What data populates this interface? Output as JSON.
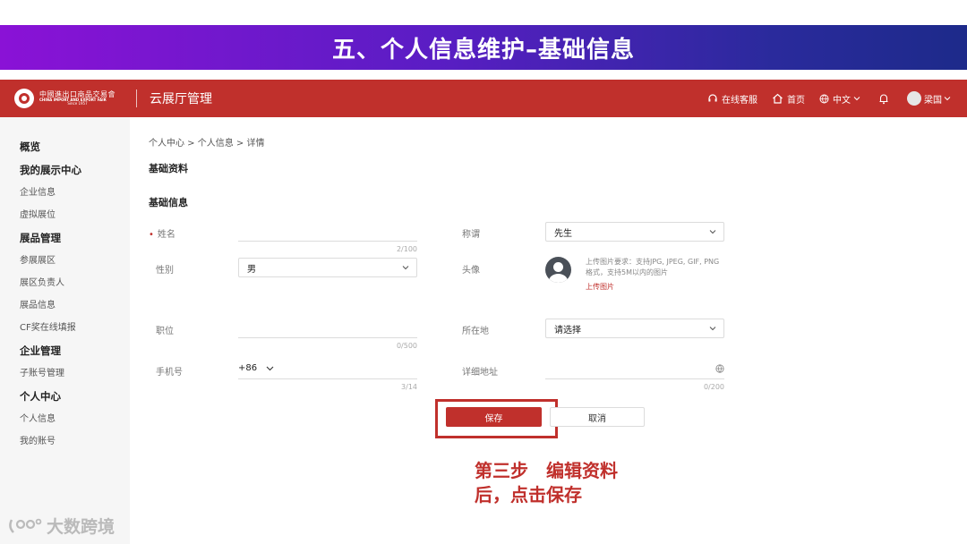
{
  "banner": {
    "title": "五、个人信息维护–基础信息"
  },
  "header": {
    "logo_cn": "中國進出口商品交易會",
    "logo_en": "CHINA IMPORT AND EXPORT FAIR",
    "logo_since": "Since 1957",
    "app_title": "云展厅管理",
    "service": "在线客服",
    "home": "首页",
    "language": "中文",
    "user": "梁国"
  },
  "sidebar": {
    "overview": "概览",
    "showcase_group": "我的展示中心",
    "company_info": "企业信息",
    "virtual_booth": "虚拟展位",
    "products_group": "展品管理",
    "exhibit_zone": "参展展区",
    "zone_manager": "展区负责人",
    "product_info": "展品信息",
    "cf_award": "CF奖在线填报",
    "company_group": "企业管理",
    "sub_accounts": "子账号管理",
    "personal_group": "个人中心",
    "personal_info": "个人信息",
    "my_account": "我的账号"
  },
  "breadcrumb": "个人中心 > 个人信息 > 详情",
  "sections": {
    "basic_profile": "基础资料",
    "basic_info": "基础信息"
  },
  "form": {
    "required_mark": "•",
    "name_label": "姓名",
    "name_counter": "2/100",
    "gender_label": "性别",
    "gender_value": "男",
    "title_label": "称谓",
    "title_value": "先生",
    "avatar_label": "头像",
    "upload_hint": "上传图片要求：支持JPG, JPEG, GIF, PNG格式，支持5M以内的图片",
    "upload_link": "上传图片",
    "position_label": "职位",
    "position_counter": "0/500",
    "location_label": "所在地",
    "location_value": "请选择",
    "phone_label": "手机号",
    "phone_prefix": "+86",
    "phone_counter": "3/14",
    "address_label": "详细地址",
    "address_counter": "0/200"
  },
  "buttons": {
    "save": "保存",
    "cancel": "取消"
  },
  "annotation": {
    "line1": "第三步　编辑资料",
    "line2": "后，点击保存"
  },
  "watermark": "大数跨境",
  "colors": {
    "brand_red": "#c0302c",
    "banner_start": "#8a12d6",
    "banner_end": "#1d2a8a"
  }
}
